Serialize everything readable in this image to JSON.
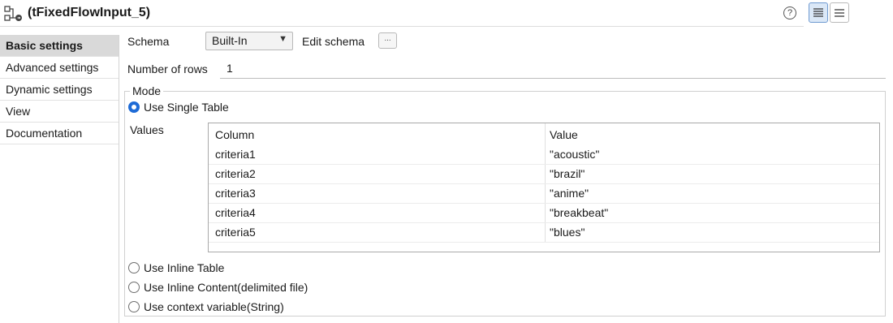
{
  "window": {
    "title": "(tFixedFlowInput_5)",
    "help_glyph": "?"
  },
  "nav": {
    "items": [
      {
        "label": "Basic settings",
        "selected": true
      },
      {
        "label": "Advanced settings"
      },
      {
        "label": "Dynamic settings"
      },
      {
        "label": "View"
      },
      {
        "label": "Documentation"
      }
    ]
  },
  "settings": {
    "schema_label": "Schema",
    "schema_value": "Built-In",
    "edit_schema_label": "Edit schema",
    "edit_schema_button": "...",
    "rows_label": "Number of rows",
    "rows_value": "1"
  },
  "mode": {
    "legend": "Mode",
    "use_single_table": "Use Single Table",
    "values_label": "Values",
    "table": {
      "headers": [
        "Column",
        "Value"
      ],
      "rows": [
        [
          "criteria1",
          "\"acoustic\""
        ],
        [
          "criteria2",
          "\"brazil\""
        ],
        [
          "criteria3",
          "\"anime\""
        ],
        [
          "criteria4",
          "\"breakbeat\""
        ],
        [
          "criteria5",
          "\"blues\""
        ]
      ]
    },
    "use_inline_table": "Use Inline Table",
    "use_inline_content": "Use Inline Content(delimited file)",
    "use_context_variable": "Use context variable(String)",
    "selected_option": "Use Single Table"
  },
  "colors": {
    "accent": "#1e6bd6",
    "selected_nav_bg": "#d9d9d9"
  }
}
